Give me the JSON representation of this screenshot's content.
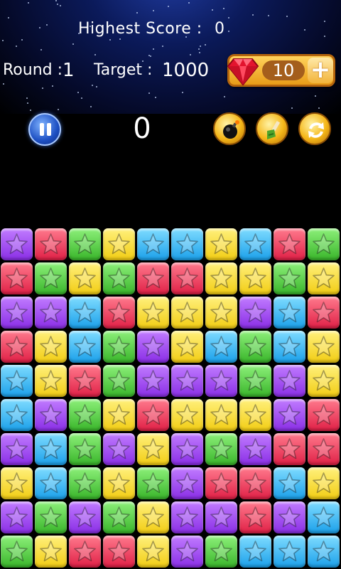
{
  "header": {
    "highest_score_label": "Highest Score :",
    "highest_score_value": "0",
    "round_label": "Round :",
    "round_value": "1",
    "target_label": "Target :",
    "target_value": "1000"
  },
  "gems": {
    "count": "10",
    "add_icon": "plus-icon",
    "icon": "ruby-gem-icon"
  },
  "score": "0",
  "tools": [
    {
      "name": "bomb",
      "icon": "bomb-icon"
    },
    {
      "name": "brush",
      "icon": "paint-brush-icon"
    },
    {
      "name": "refresh",
      "icon": "refresh-icon"
    }
  ],
  "colors": {
    "P": "#a550f2",
    "R": "#ef3a5c",
    "G": "#5ccf48",
    "Y": "#f7dd3a",
    "B": "#3cb8f4"
  },
  "board": [
    [
      "P",
      "R",
      "G",
      "Y",
      "B",
      "B",
      "Y",
      "B",
      "R",
      "G"
    ],
    [
      "R",
      "G",
      "Y",
      "G",
      "R",
      "R",
      "Y",
      "Y",
      "G",
      "Y"
    ],
    [
      "P",
      "P",
      "B",
      "R",
      "Y",
      "Y",
      "Y",
      "P",
      "B",
      "R"
    ],
    [
      "R",
      "Y",
      "B",
      "G",
      "P",
      "Y",
      "B",
      "G",
      "B",
      "Y"
    ],
    [
      "B",
      "Y",
      "R",
      "G",
      "P",
      "P",
      "P",
      "G",
      "P",
      "Y"
    ],
    [
      "B",
      "P",
      "G",
      "Y",
      "R",
      "Y",
      "Y",
      "Y",
      "P",
      "R"
    ],
    [
      "P",
      "B",
      "G",
      "P",
      "Y",
      "P",
      "G",
      "P",
      "R",
      "R"
    ],
    [
      "Y",
      "B",
      "G",
      "Y",
      "G",
      "P",
      "R",
      "R",
      "B",
      "Y"
    ],
    [
      "P",
      "G",
      "P",
      "G",
      "Y",
      "P",
      "P",
      "R",
      "P",
      "B"
    ],
    [
      "G",
      "Y",
      "R",
      "R",
      "Y",
      "P",
      "G",
      "B",
      "B",
      "B"
    ]
  ]
}
